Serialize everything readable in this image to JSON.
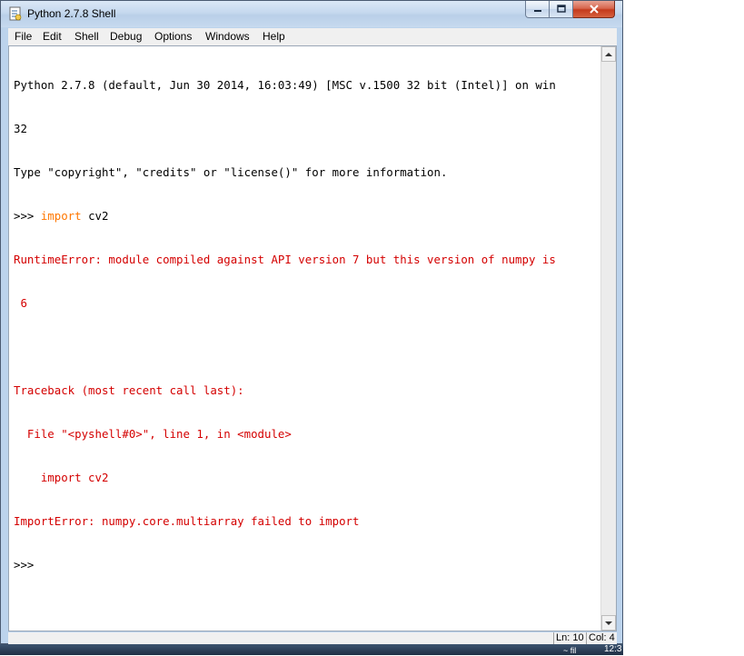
{
  "window": {
    "title": "Python 2.7.8 Shell"
  },
  "menu": {
    "file": "File",
    "edit": "Edit",
    "shell": "Shell",
    "debug": "Debug",
    "options": "Options",
    "windows": "Windows",
    "help": "Help"
  },
  "shell": {
    "line1": "Python 2.7.8 (default, Jun 30 2014, 16:03:49) [MSC v.1500 32 bit (Intel)] on win",
    "line2": "32",
    "line3": "Type \"copyright\", \"credits\" or \"license()\" for more information.",
    "prompt1": ">>> ",
    "keyword_import": "import",
    "module_cv2": " cv2",
    "runtime_error": "RuntimeError: module compiled against API version 7 but this version of numpy is",
    "runtime_error_cont": " 6",
    "traceback_header": "Traceback (most recent call last):",
    "traceback_file": "  File \"<pyshell#0>\", line 1, in <module>",
    "traceback_code": "    import cv2",
    "import_error": "ImportError: numpy.core.multiarray failed to import",
    "prompt2": ">>>"
  },
  "status": {
    "line": "Ln: 10",
    "col": "Col: 4"
  },
  "taskbar": {
    "clock": "12:3",
    "fragment": "~ fil"
  },
  "colors": {
    "error": "#d40000",
    "keyword": "#ff7700"
  }
}
